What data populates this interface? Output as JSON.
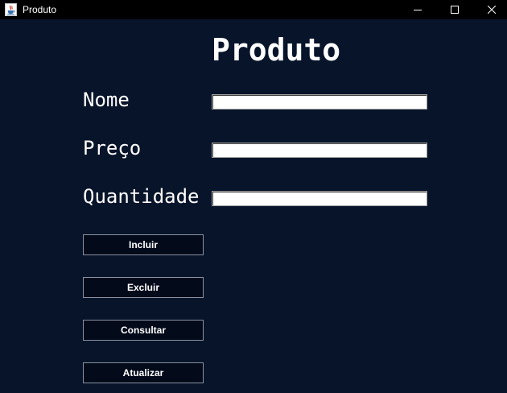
{
  "window": {
    "title": "Produto",
    "icons": {
      "app": "java-cup-icon",
      "minimize": "minimize-icon",
      "maximize": "maximize-icon",
      "close": "close-icon"
    }
  },
  "form": {
    "heading": "Produto",
    "fields": [
      {
        "label": "Nome",
        "value": ""
      },
      {
        "label": "Preço",
        "value": ""
      },
      {
        "label": "Quantidade",
        "value": ""
      }
    ],
    "buttons": [
      {
        "label": "Incluir"
      },
      {
        "label": "Excluir"
      },
      {
        "label": "Consultar"
      },
      {
        "label": "Atualizar"
      }
    ]
  },
  "colors": {
    "background": "#08142a",
    "titlebar": "#000000",
    "button_background": "#030a1a",
    "button_border": "#8a93a3",
    "text": "#ffffff"
  }
}
